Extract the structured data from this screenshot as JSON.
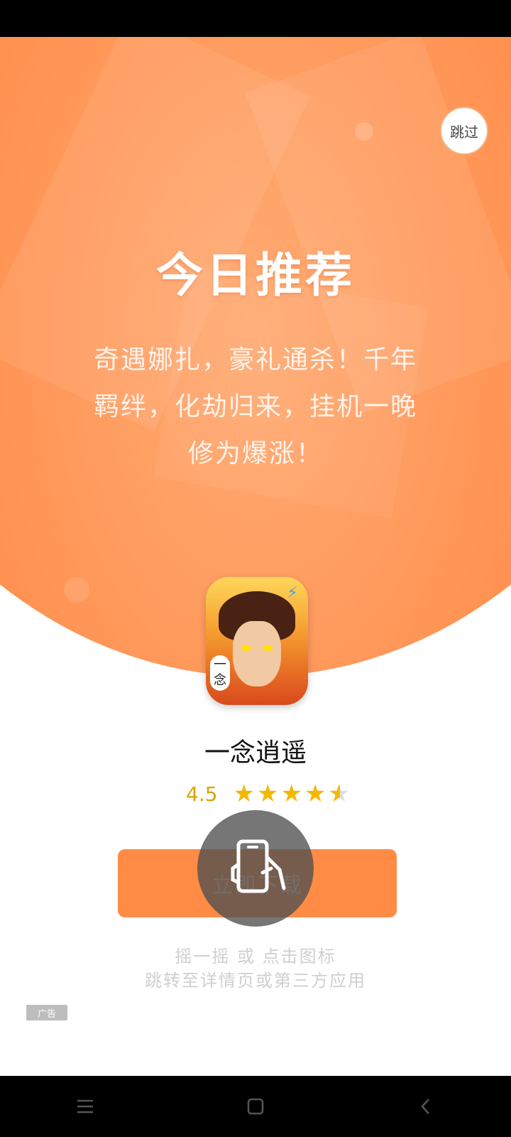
{
  "skip": {
    "label": "跳过"
  },
  "promo": {
    "headline": "今日推荐",
    "lines": [
      "奇遇娜扎，豪礼通杀！千年",
      "羁绊，化劫归来，挂机一晚",
      "修为爆涨！"
    ]
  },
  "app": {
    "name": "一念逍遥",
    "icon_tag": "一念",
    "rating": "4.5",
    "rating_value": 4.5,
    "rating_max": 5
  },
  "download": {
    "label": "立即下载"
  },
  "hint": {
    "line1": "摇一摇 或 点击图标",
    "line2": "跳转至详情页或第三方应用"
  },
  "ad_badge": {
    "label": "广告"
  },
  "nav": {
    "icons": [
      "menu-icon",
      "home-icon",
      "back-icon"
    ]
  },
  "colors": {
    "accent": "#ff8b45",
    "star": "#f5b800",
    "rating_text": "#d9a400"
  }
}
